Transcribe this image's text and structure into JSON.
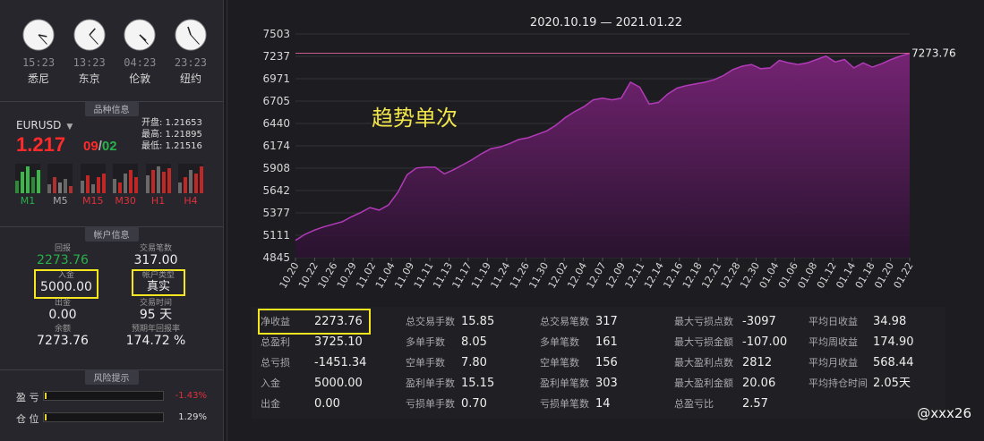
{
  "clocks": [
    {
      "time": "15:23",
      "city": "悉尼",
      "hour": 15,
      "minute": 23
    },
    {
      "time": "13:23",
      "city": "东京",
      "hour": 13,
      "minute": 23
    },
    {
      "time": "04:23",
      "city": "伦敦",
      "hour": 4,
      "minute": 23
    },
    {
      "time": "23:23",
      "city": "纽约",
      "hour": 23,
      "minute": 23
    }
  ],
  "sections": {
    "instrument": "品种信息",
    "account": "帐户信息",
    "risk": "风险提示"
  },
  "instrument": {
    "symbol": "EURUSD",
    "price_big": "1.217",
    "price_small_red": "09",
    "price_small_sep": "/",
    "price_small_green": "02",
    "open": "开盘: 1.21653",
    "high": "最高: 1.21895",
    "low": "最低: 1.21516",
    "timeframes": [
      {
        "label": "M1",
        "tone": "green"
      },
      {
        "label": "M5",
        "tone": "gray"
      },
      {
        "label": "M15",
        "tone": "red"
      },
      {
        "label": "M30",
        "tone": "red"
      },
      {
        "label": "H1",
        "tone": "red"
      },
      {
        "label": "H4",
        "tone": "red"
      }
    ]
  },
  "account": {
    "drawdown_label": "回报",
    "drawdown_value": "2273.76",
    "trade_count_label": "交易笔数",
    "trade_count_value": "317.00",
    "deposit_label": "入金",
    "deposit_value": "5000.00",
    "account_type_label": "帐户类型",
    "account_type_value": "真实",
    "withdraw_label": "出金",
    "withdraw_value": "0.00",
    "trade_time_label": "交易时间",
    "trade_time_value": "95 天",
    "balance_label": "余额",
    "balance_value": "7273.76",
    "annual_label": "预期年回报率",
    "annual_value": "174.72 %"
  },
  "risk": {
    "profit_label": "盈 亏",
    "profit_value": "-1.43%",
    "profit_level": 0.0143,
    "position_label": "仓 位",
    "position_value": "1.29%",
    "position_level": 0.0129
  },
  "chart": {
    "title": "2020.10.19 — 2021.01.22",
    "watermark": "趋势单次",
    "last_value_label": "7273.76",
    "colors": {
      "line": "#b23ab8",
      "fill_top": "#7a2478",
      "fill_bottom": "#2a1230",
      "grid": "#333338",
      "ref": "#c75a8e"
    }
  },
  "chart_data": {
    "type": "area",
    "title": "2020.10.19 — 2021.01.22",
    "y_ticks": [
      "7503",
      "7237",
      "6971",
      "6705",
      "6440",
      "6174",
      "5908",
      "5642",
      "5377",
      "5111",
      "4845"
    ],
    "ylim": [
      4845,
      7503
    ],
    "x_ticks": [
      "10.20",
      "10.22",
      "10.26",
      "10.29",
      "11.02",
      "11.04",
      "11.09",
      "11.11",
      "11.13",
      "11.17",
      "11.19",
      "11.24",
      "11.26",
      "11.30",
      "12.02",
      "12.04",
      "12.07",
      "12.09",
      "12.11",
      "12.14",
      "12.16",
      "12.18",
      "12.21",
      "12.28",
      "12.30",
      "01.04",
      "01.06",
      "01.08",
      "01.12",
      "01.14",
      "01.18",
      "01.20",
      "01.22"
    ],
    "reference_line": 7273.76,
    "series": [
      {
        "values": [
          5050,
          5120,
          5170,
          5210,
          5240,
          5270,
          5330,
          5380,
          5440,
          5410,
          5470,
          5620,
          5830,
          5910,
          5920,
          5920,
          5840,
          5890,
          5950,
          6010,
          6080,
          6140,
          6160,
          6200,
          6250,
          6270,
          6310,
          6350,
          6420,
          6510,
          6580,
          6640,
          6720,
          6740,
          6720,
          6740,
          6930,
          6870,
          6670,
          6690,
          6790,
          6860,
          6890,
          6910,
          6930,
          6960,
          7010,
          7080,
          7120,
          7140,
          7090,
          7100,
          7190,
          7160,
          7140,
          7160,
          7200,
          7240,
          7170,
          7200,
          7100,
          7160,
          7110,
          7150,
          7200,
          7240,
          7273.76
        ]
      }
    ]
  },
  "stats": {
    "columns": [
      [
        {
          "k": "净收益",
          "v": "2273.76"
        },
        {
          "k": "总盈利",
          "v": "3725.10"
        },
        {
          "k": "总亏损",
          "v": "-1451.34"
        },
        {
          "k": "入金",
          "v": "5000.00"
        },
        {
          "k": "出金",
          "v": "0.00"
        }
      ],
      [
        {
          "k": "总交易手数",
          "v": "15.85"
        },
        {
          "k": "多单手数",
          "v": "8.05"
        },
        {
          "k": "空单手数",
          "v": "7.80"
        },
        {
          "k": "盈利单手数",
          "v": "15.15"
        },
        {
          "k": "亏损单手数",
          "v": "0.70"
        }
      ],
      [
        {
          "k": "总交易笔数",
          "v": "317"
        },
        {
          "k": "多单笔数",
          "v": "161"
        },
        {
          "k": "空单笔数",
          "v": "156"
        },
        {
          "k": "盈利单笔数",
          "v": "303"
        },
        {
          "k": "亏损单笔数",
          "v": "14"
        }
      ],
      [
        {
          "k": "最大亏损点数",
          "v": "-3097"
        },
        {
          "k": "最大亏损金额",
          "v": "-107.00"
        },
        {
          "k": "最大盈利点数",
          "v": "2812"
        },
        {
          "k": "最大盈利金额",
          "v": "20.06"
        },
        {
          "k": "总盈亏比",
          "v": "2.57"
        }
      ],
      [
        {
          "k": "平均日收益",
          "v": "34.98"
        },
        {
          "k": "平均周收益",
          "v": "174.90"
        },
        {
          "k": "平均月收益",
          "v": "568.44"
        },
        {
          "k": "平均持仓时间",
          "v": "2.05天"
        }
      ]
    ]
  },
  "brand": "@xxx26"
}
